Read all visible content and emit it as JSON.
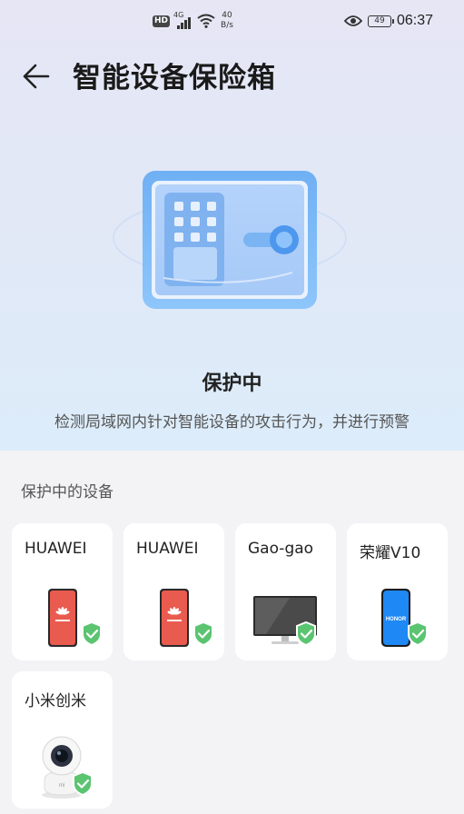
{
  "status_bar": {
    "hd": "HD",
    "signal_tag": "4G",
    "net_speed_value": "40",
    "net_speed_unit": "B/s",
    "battery": "49",
    "time": "06:37",
    "icons": [
      "hd-icon",
      "signal-icon",
      "wifi-icon",
      "eye-icon",
      "battery-icon"
    ]
  },
  "header": {
    "back_icon": "back-arrow-icon",
    "title": "智能设备保险箱"
  },
  "hero": {
    "illustration": "safe-box-icon",
    "status_title": "保护中",
    "status_description": "检测局域网内针对智能设备的攻击行为，并进行预警"
  },
  "devices": {
    "section_title": "保护中的设备",
    "items": [
      {
        "name": "HUAWEI",
        "type": "phone",
        "brand": "huawei",
        "icon": "phone-icon",
        "protected": true
      },
      {
        "name": "HUAWEI",
        "type": "phone",
        "brand": "huawei",
        "icon": "phone-icon",
        "protected": true
      },
      {
        "name": "Gao-gao",
        "type": "monitor",
        "icon": "monitor-icon",
        "protected": true
      },
      {
        "name": "荣耀V10",
        "type": "phone",
        "brand": "honor",
        "screen_text": "HONOR",
        "icon": "phone-icon",
        "protected": true
      },
      {
        "name": "小米创米",
        "type": "camera",
        "brand": "mi",
        "icon": "camera-icon",
        "protected": true
      }
    ],
    "badge_icon": "shield-check-icon"
  },
  "colors": {
    "hero_top": "#e6e6f5",
    "hero_bottom": "#dcecfa",
    "safe_blue": "#7ab4f2",
    "shield_green": "#5bc470",
    "huawei_red": "#ea5b4f",
    "honor_blue": "#1e88f5"
  }
}
